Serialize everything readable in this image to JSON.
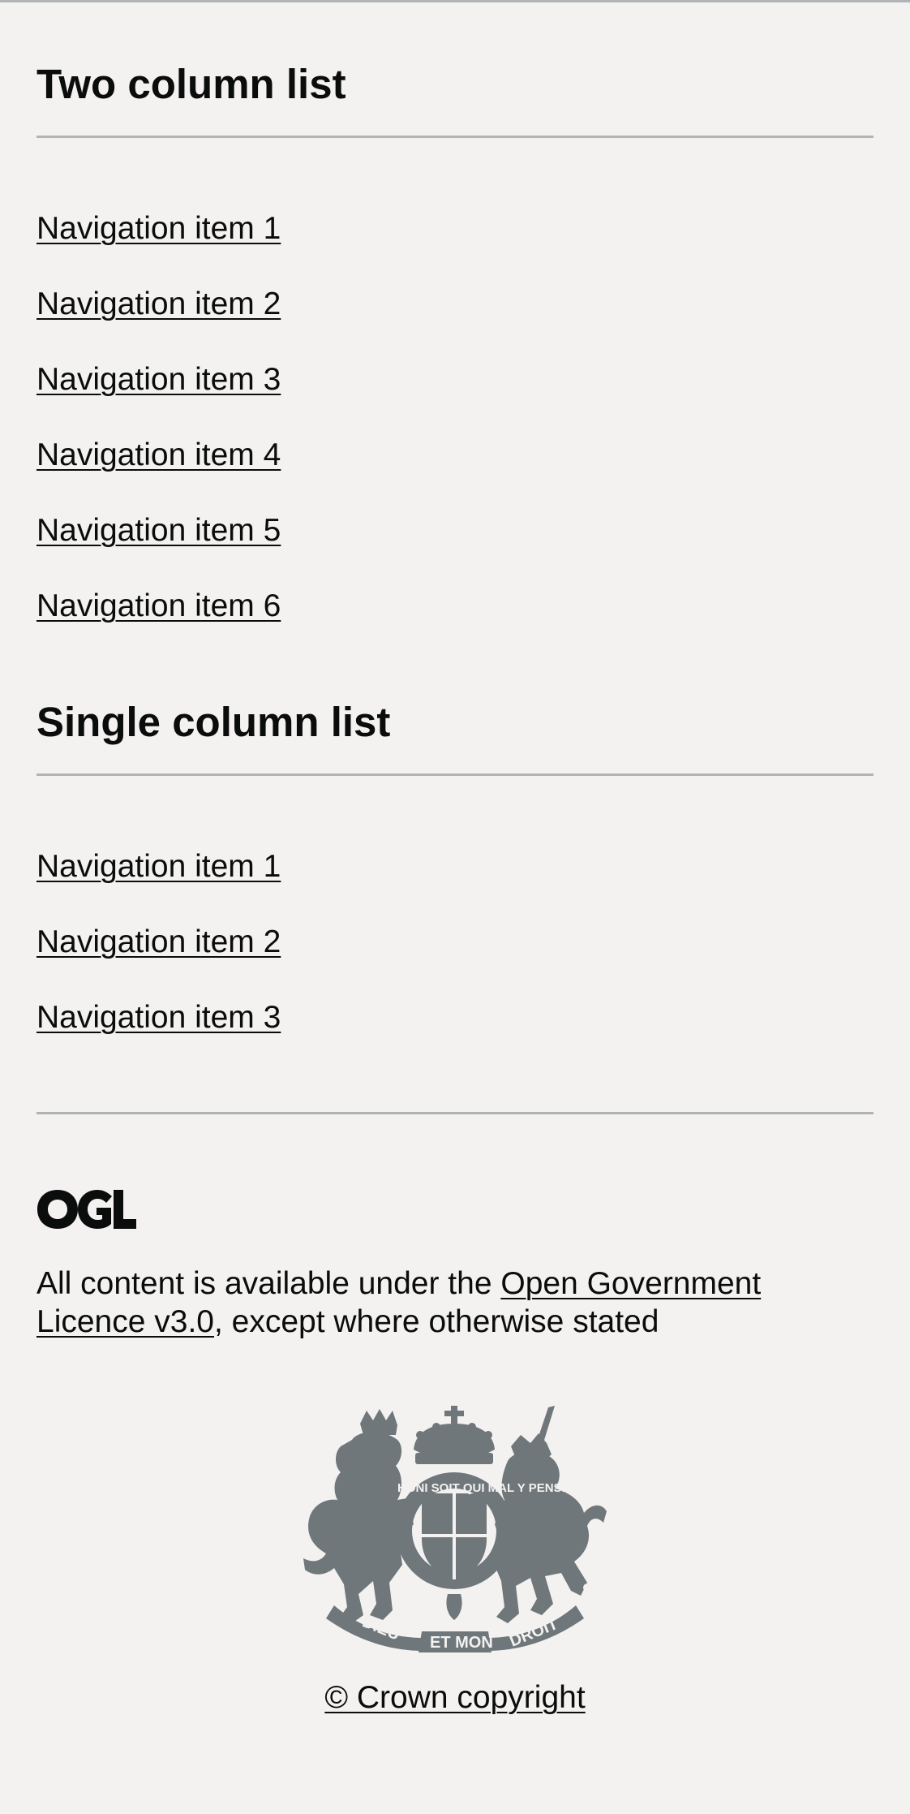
{
  "two_column": {
    "heading": "Two column list",
    "items": [
      {
        "label": "Navigation item 1"
      },
      {
        "label": "Navigation item 2"
      },
      {
        "label": "Navigation item 3"
      },
      {
        "label": "Navigation item 4"
      },
      {
        "label": "Navigation item 5"
      },
      {
        "label": "Navigation item 6"
      }
    ]
  },
  "single_column": {
    "heading": "Single column list",
    "items": [
      {
        "label": "Navigation item 1"
      },
      {
        "label": "Navigation item 2"
      },
      {
        "label": "Navigation item 3"
      }
    ]
  },
  "footer": {
    "ogl_logo_text": "OGL",
    "licence_prefix": "All content is available under the ",
    "licence_link": "Open Government Licence v3.0",
    "licence_suffix": ", except where otherwise stated",
    "crest_motto_left": "DIEU",
    "crest_motto_mid": "ET MON",
    "crest_motto_right": "DROIT",
    "crest_garter": "HONI SOIT QUI MAL Y PENSE",
    "copyright": "© Crown copyright",
    "crest_color": "#6f777b"
  }
}
